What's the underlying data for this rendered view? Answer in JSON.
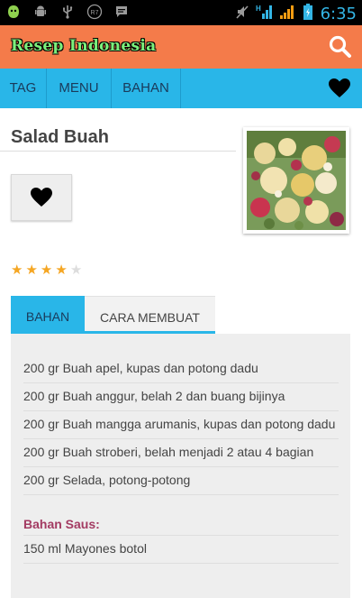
{
  "status_bar": {
    "time": "6:35",
    "left_icons": [
      "android-debug-icon",
      "android-icon",
      "usb-icon",
      "notification-badge-icon",
      "message-icon"
    ],
    "right_icons": [
      "no-sound-icon",
      "hd-signal-icon",
      "signal-bars-icon",
      "battery-icon"
    ],
    "badge_text": "R7"
  },
  "app_bar": {
    "title": "Resep Indonesia",
    "search_icon": "search-icon",
    "color": "#f47b4a"
  },
  "nav": {
    "items": [
      {
        "label": "TAG"
      },
      {
        "label": "MENU"
      },
      {
        "label": "BAHAN"
      }
    ],
    "favorite_icon": "heart-icon",
    "color": "#29b6e8"
  },
  "recipe": {
    "title": "Salad Buah",
    "rating": 4,
    "rating_max": 5,
    "favorite_icon": "heart-icon"
  },
  "tabs": [
    {
      "label": "BAHAN",
      "active": true
    },
    {
      "label": "CARA MEMBUAT",
      "active": false
    }
  ],
  "ingredients": [
    "200 gr Buah apel, kupas dan potong dadu",
    "200 gr Buah anggur, belah 2 dan buang bijinya",
    "200 gr Buah mangga arumanis, kupas dan potong dadu",
    "200 gr Buah stroberi, belah menjadi 2 atau 4 bagian",
    "200 gr Selada, potong-potong"
  ],
  "sauce": {
    "heading": "Bahan Saus:",
    "items": [
      "150 ml Mayones botol"
    ]
  },
  "colors": {
    "accent": "#29b6e8",
    "app_bar": "#f47b4a",
    "star_on": "#f5a623",
    "star_off": "#dddddd",
    "subheading": "#a33b62"
  }
}
